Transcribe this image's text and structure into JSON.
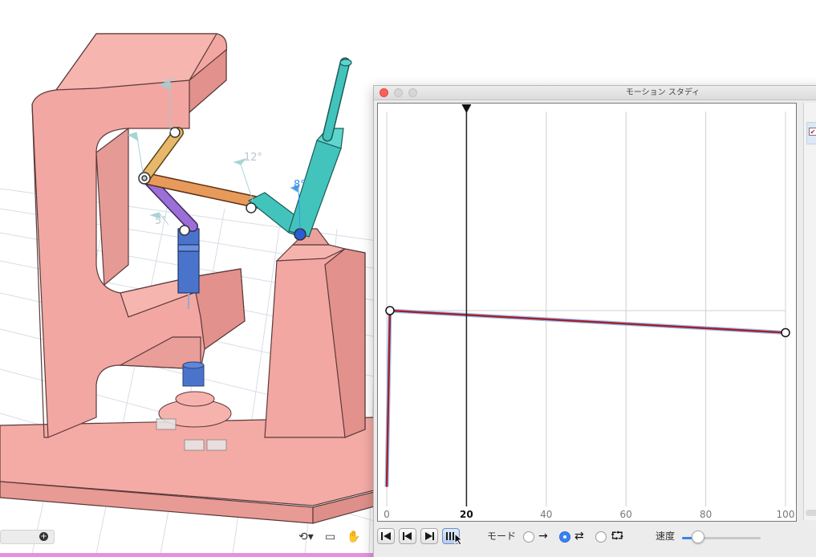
{
  "window": {
    "title": "モーション スタディ"
  },
  "viewport": {
    "angle_labels": [
      "1°",
      "12°",
      "5°",
      "8°"
    ],
    "colors": {
      "frame": "#f2a7a2",
      "link_orange": "#e89a5a",
      "link_yellow": "#e8b86a",
      "link_purple": "#9b6fd6",
      "cylinder_blue": "#4a74cc",
      "lever_teal": "#42c4bc"
    },
    "toolbar_icons": [
      "plus-icon",
      "orbit-icon",
      "look-at-icon",
      "pan-hand-icon"
    ]
  },
  "chart_data": {
    "type": "line",
    "x_ticks": [
      "0",
      "20",
      "40",
      "60",
      "80",
      "100"
    ],
    "xlim": [
      0,
      100
    ],
    "current_time": 20,
    "series": [
      {
        "color": "#a61e2b",
        "x": [
          0,
          0.8,
          100
        ],
        "y": [
          -36,
          0,
          -4.5
        ]
      }
    ],
    "keyframes": [
      {
        "x": 0.8,
        "y": 0
      },
      {
        "x": 100,
        "y": -4.5
      }
    ],
    "reference_line_y": 0,
    "grid": true
  },
  "controls": {
    "buttons": [
      {
        "icon": "skip-to-start-icon"
      },
      {
        "icon": "step-back-icon"
      },
      {
        "icon": "step-forward-icon"
      },
      {
        "icon": "play-pause-icon"
      }
    ],
    "mode_label": "モード",
    "mode_options": [
      {
        "icon": "arrow-right-icon",
        "glyph": "→",
        "selected": false
      },
      {
        "icon": "ping-pong-icon",
        "glyph": "⇄",
        "selected": true
      },
      {
        "icon": "loop-icon",
        "glyph": "⮔",
        "selected": false
      }
    ],
    "speed_label": "速度",
    "speed_value": 0.12
  }
}
